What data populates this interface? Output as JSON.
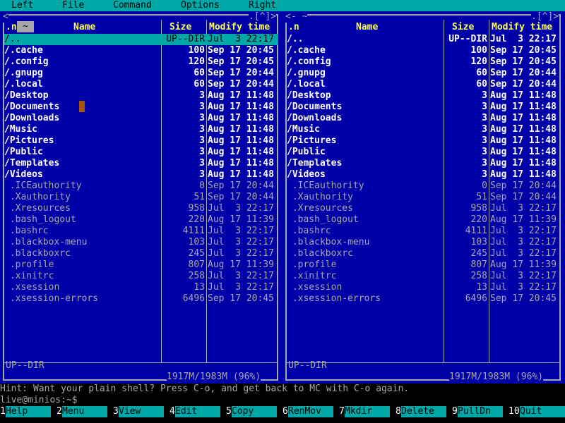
{
  "menu": [
    "Left",
    "File",
    "Command",
    "Options",
    "Right"
  ],
  "columns": {
    "name": ".n",
    "name_title": "Name",
    "size": "Size",
    "time": "Modify time"
  },
  "left_panel": {
    "corner_left": "<",
    "corner_right": ".[^]>",
    "status": "UP--DIR",
    "disk": "1917M/1983M (96%)"
  },
  "right_panel": {
    "corner_left": "<- ~",
    "corner_right": ".[^]>",
    "status": "UP--DIR",
    "disk": "1917M/1983M (96%)"
  },
  "left_tilde": "~",
  "files": [
    {
      "name": "/..",
      "size": "UP--DIR",
      "time": "Jul  3 22:17",
      "kind": "dir"
    },
    {
      "name": "/.cache",
      "size": "100",
      "time": "Sep 17 20:45",
      "kind": "dir"
    },
    {
      "name": "/.config",
      "size": "120",
      "time": "Sep 17 20:45",
      "kind": "dir"
    },
    {
      "name": "/.gnupg",
      "size": "60",
      "time": "Sep 17 20:44",
      "kind": "dir"
    },
    {
      "name": "/.local",
      "size": "60",
      "time": "Sep 17 20:44",
      "kind": "dir"
    },
    {
      "name": "/Desktop",
      "size": "3",
      "time": "Aug 17 11:48",
      "kind": "dir"
    },
    {
      "name": "/Documents",
      "size": "3",
      "time": "Aug 17 11:48",
      "kind": "dir"
    },
    {
      "name": "/Downloads",
      "size": "3",
      "time": "Aug 17 11:48",
      "kind": "dir"
    },
    {
      "name": "/Music",
      "size": "3",
      "time": "Aug 17 11:48",
      "kind": "dir"
    },
    {
      "name": "/Pictures",
      "size": "3",
      "time": "Aug 17 11:48",
      "kind": "dir"
    },
    {
      "name": "/Public",
      "size": "3",
      "time": "Aug 17 11:48",
      "kind": "dir"
    },
    {
      "name": "/Templates",
      "size": "3",
      "time": "Aug 17 11:48",
      "kind": "dir"
    },
    {
      "name": "/Videos",
      "size": "3",
      "time": "Aug 17 11:48",
      "kind": "dir"
    },
    {
      "name": " .ICEauthority",
      "size": "0",
      "time": "Sep 17 20:44",
      "kind": "file"
    },
    {
      "name": " .Xauthority",
      "size": "51",
      "time": "Sep 17 20:44",
      "kind": "file"
    },
    {
      "name": " .Xresources",
      "size": "958",
      "time": "Jul  3 22:17",
      "kind": "file"
    },
    {
      "name": " .bash_logout",
      "size": "220",
      "time": "Aug 17 11:39",
      "kind": "file"
    },
    {
      "name": " .bashrc",
      "size": "4111",
      "time": "Jul  3 22:17",
      "kind": "file"
    },
    {
      "name": " .blackbox-menu",
      "size": "103",
      "time": "Jul  3 22:17",
      "kind": "file"
    },
    {
      "name": " .blackboxrc",
      "size": "245",
      "time": "Jul  3 22:17",
      "kind": "file"
    },
    {
      "name": " .profile",
      "size": "807",
      "time": "Aug 17 11:39",
      "kind": "file"
    },
    {
      "name": " .xinitrc",
      "size": "258",
      "time": "Jul  3 22:17",
      "kind": "file"
    },
    {
      "name": " .xsession",
      "size": "13",
      "time": "Jul  3 22:17",
      "kind": "file"
    },
    {
      "name": " .xsession-errors",
      "size": "6496",
      "time": "Sep 17 20:45",
      "kind": "file"
    }
  ],
  "hint": "Hint: Want your plain shell? Press C-o, and get back to MC with C-o again.",
  "prompt": "live@minios:~$",
  "fkeys": [
    {
      "num": "1",
      "label": "Help"
    },
    {
      "num": "2",
      "label": "Menu"
    },
    {
      "num": "3",
      "label": "View"
    },
    {
      "num": "4",
      "label": "Edit"
    },
    {
      "num": "5",
      "label": "Copy"
    },
    {
      "num": "6",
      "label": "RenMov"
    },
    {
      "num": "7",
      "label": "Mkdir"
    },
    {
      "num": "8",
      "label": "Delete"
    },
    {
      "num": "9",
      "label": "PullDn"
    },
    {
      "num": "10",
      "label": "Quit"
    }
  ],
  "colors": {
    "panel_bg": "#0000a8",
    "menu_bg": "#00a8a8",
    "header": "#ffff55",
    "dir": "#ffffff",
    "file": "#a8a8a8"
  }
}
